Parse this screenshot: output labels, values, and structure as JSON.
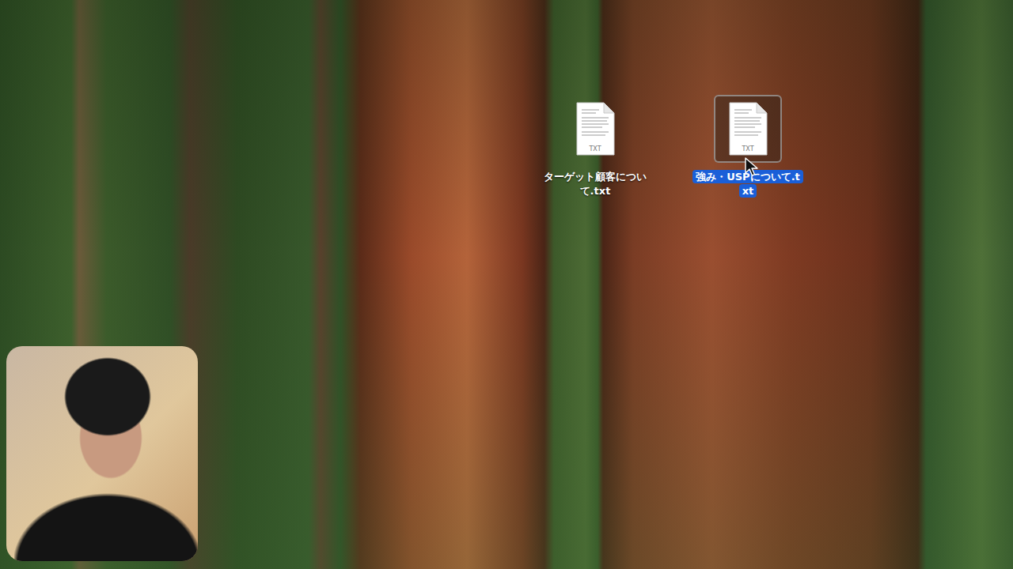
{
  "desktop": {
    "files": [
      {
        "name": "ターゲット顧客について.txt",
        "badge": "TXT",
        "selected": false
      },
      {
        "name": "強み・USPについて.txt",
        "badge": "TXT",
        "selected": true
      }
    ]
  }
}
